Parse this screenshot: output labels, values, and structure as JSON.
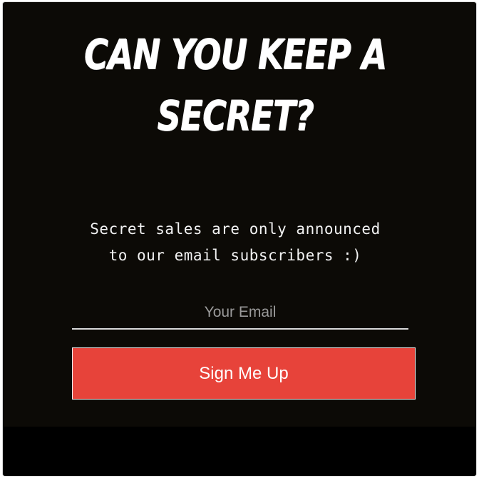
{
  "popup": {
    "headline_line1": "Can You Keep A",
    "headline_line2": "Secret?",
    "description_line1": "Secret sales are only announced",
    "description_line2": "to our email subscribers :)",
    "email_placeholder": "Your Email",
    "email_value": "",
    "button_label": "Sign Me Up"
  },
  "colors": {
    "background": "#0c0a06",
    "button": "#e7433a",
    "text": "#ffffff",
    "placeholder": "#9a9a9a"
  }
}
